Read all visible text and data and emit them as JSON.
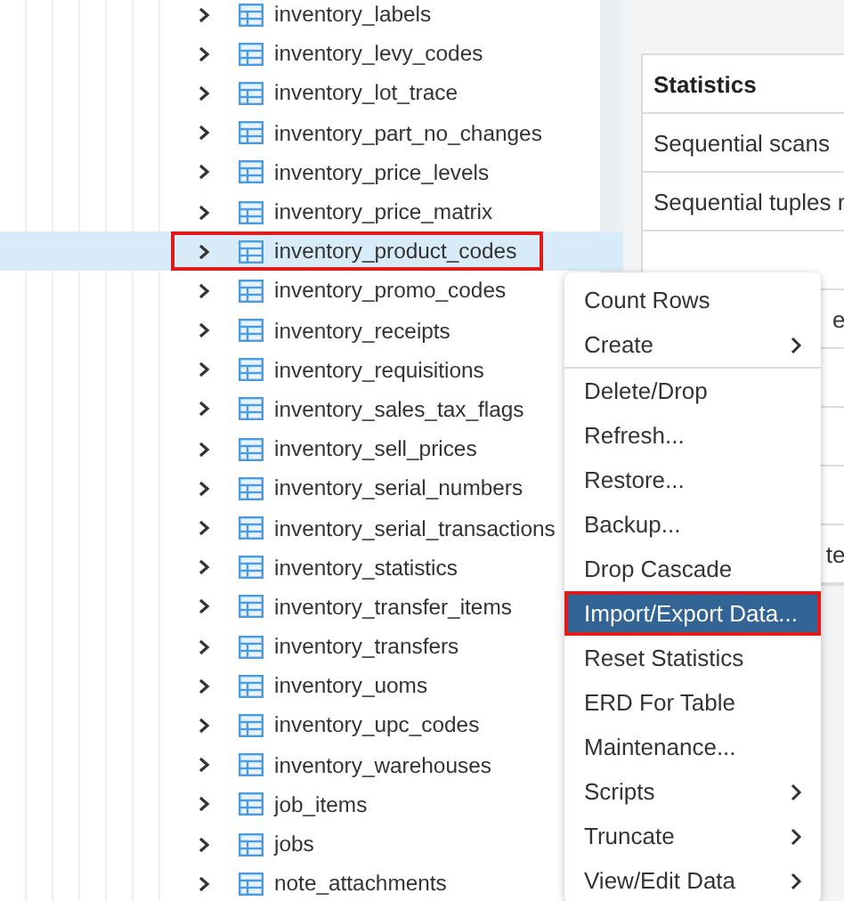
{
  "tree": {
    "items": [
      {
        "label": "inventory_labels",
        "selected": false,
        "outlined": false
      },
      {
        "label": "inventory_levy_codes",
        "selected": false,
        "outlined": false
      },
      {
        "label": "inventory_lot_trace",
        "selected": false,
        "outlined": false
      },
      {
        "label": "inventory_part_no_changes",
        "selected": false,
        "outlined": false
      },
      {
        "label": "inventory_price_levels",
        "selected": false,
        "outlined": false
      },
      {
        "label": "inventory_price_matrix",
        "selected": false,
        "outlined": false
      },
      {
        "label": "inventory_product_codes",
        "selected": true,
        "outlined": true
      },
      {
        "label": "inventory_promo_codes",
        "selected": false,
        "outlined": false
      },
      {
        "label": "inventory_receipts",
        "selected": false,
        "outlined": false
      },
      {
        "label": "inventory_requisitions",
        "selected": false,
        "outlined": false
      },
      {
        "label": "inventory_sales_tax_flags",
        "selected": false,
        "outlined": false
      },
      {
        "label": "inventory_sell_prices",
        "selected": false,
        "outlined": false
      },
      {
        "label": "inventory_serial_numbers",
        "selected": false,
        "outlined": false
      },
      {
        "label": "inventory_serial_transactions",
        "selected": false,
        "outlined": false
      },
      {
        "label": "inventory_statistics",
        "selected": false,
        "outlined": false
      },
      {
        "label": "inventory_transfer_items",
        "selected": false,
        "outlined": false
      },
      {
        "label": "inventory_transfers",
        "selected": false,
        "outlined": false
      },
      {
        "label": "inventory_uoms",
        "selected": false,
        "outlined": false
      },
      {
        "label": "inventory_upc_codes",
        "selected": false,
        "outlined": false
      },
      {
        "label": "inventory_warehouses",
        "selected": false,
        "outlined": false
      },
      {
        "label": "job_items",
        "selected": false,
        "outlined": false
      },
      {
        "label": "jobs",
        "selected": false,
        "outlined": false
      },
      {
        "label": "note_attachments",
        "selected": false,
        "outlined": false
      }
    ]
  },
  "statistics": {
    "header": "Statistics",
    "rows": [
      {
        "column_1": "Sequential scans"
      },
      {
        "column_1": "Sequential tuples r"
      },
      {
        "column_1": ""
      },
      {
        "column_1": "e"
      },
      {
        "column_1": ""
      },
      {
        "column_1": ""
      },
      {
        "column_1": ""
      },
      {
        "column_1": "te"
      }
    ]
  },
  "context_menu": {
    "items": [
      {
        "label": "Count Rows",
        "submenu": false,
        "selected": false,
        "outlined": false,
        "divider_after": false
      },
      {
        "label": "Create",
        "submenu": true,
        "selected": false,
        "outlined": false,
        "divider_after": true
      },
      {
        "label": "Delete/Drop",
        "submenu": false,
        "selected": false,
        "outlined": false,
        "divider_after": false
      },
      {
        "label": "Refresh...",
        "submenu": false,
        "selected": false,
        "outlined": false,
        "divider_after": false
      },
      {
        "label": "Restore...",
        "submenu": false,
        "selected": false,
        "outlined": false,
        "divider_after": false
      },
      {
        "label": "Backup...",
        "submenu": false,
        "selected": false,
        "outlined": false,
        "divider_after": false
      },
      {
        "label": "Drop Cascade",
        "submenu": false,
        "selected": false,
        "outlined": false,
        "divider_after": false
      },
      {
        "label": "Import/Export Data...",
        "submenu": false,
        "selected": true,
        "outlined": true,
        "divider_after": false
      },
      {
        "label": "Reset Statistics",
        "submenu": false,
        "selected": false,
        "outlined": false,
        "divider_after": false
      },
      {
        "label": "ERD For Table",
        "submenu": false,
        "selected": false,
        "outlined": false,
        "divider_after": false
      },
      {
        "label": "Maintenance...",
        "submenu": false,
        "selected": false,
        "outlined": false,
        "divider_after": false
      },
      {
        "label": "Scripts",
        "submenu": true,
        "selected": false,
        "outlined": false,
        "divider_after": false
      },
      {
        "label": "Truncate",
        "submenu": true,
        "selected": false,
        "outlined": false,
        "divider_after": false
      },
      {
        "label": "View/Edit Data",
        "submenu": true,
        "selected": false,
        "outlined": false,
        "divider_after": false
      }
    ]
  }
}
